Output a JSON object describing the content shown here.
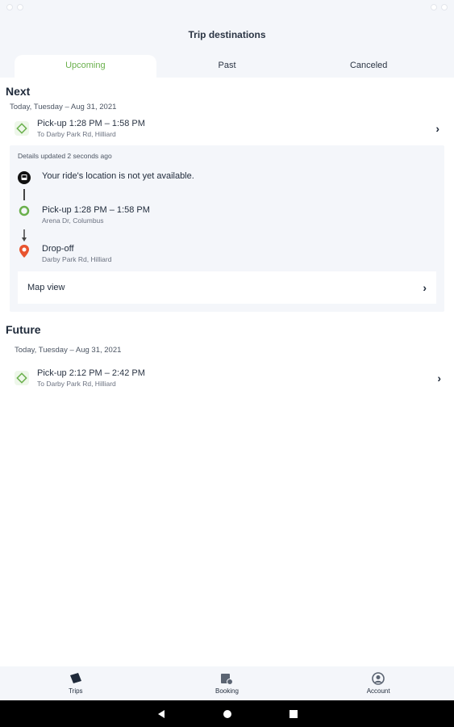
{
  "header": {
    "title": "Trip destinations"
  },
  "tabs": [
    {
      "label": "Upcoming",
      "active": true
    },
    {
      "label": "Past",
      "active": false
    },
    {
      "label": "Canceled",
      "active": false
    }
  ],
  "next": {
    "title": "Next",
    "date": "Today, Tuesday – Aug 31, 2021",
    "trip": {
      "pickup": "Pick-up 1:28 PM – 1:58 PM",
      "destination": "To Darby Park Rd, Hilliard"
    },
    "details": {
      "updated": "Details updated 2 seconds ago",
      "location_status": "Your ride's location is not yet available.",
      "pickup": {
        "label": "Pick-up 1:28 PM – 1:58 PM",
        "address": "Arena Dr, Columbus"
      },
      "dropoff": {
        "label": "Drop-off",
        "address": "Darby Park Rd, Hilliard"
      },
      "map_view": "Map view"
    }
  },
  "future": {
    "title": "Future",
    "date": "Today, Tuesday – Aug 31, 2021",
    "trip": {
      "pickup": "Pick-up 2:12 PM – 2:42 PM",
      "destination": "To Darby Park Rd, Hilliard"
    }
  },
  "bottom_nav": [
    {
      "label": "Trips",
      "icon": "ticket-icon",
      "active": true
    },
    {
      "label": "Booking",
      "icon": "calendar-clock-icon",
      "active": false
    },
    {
      "label": "Account",
      "icon": "account-icon",
      "active": false
    }
  ],
  "colors": {
    "accent": "#6ab04c",
    "dropoff": "#e8542f",
    "background": "#f4f6fa"
  }
}
